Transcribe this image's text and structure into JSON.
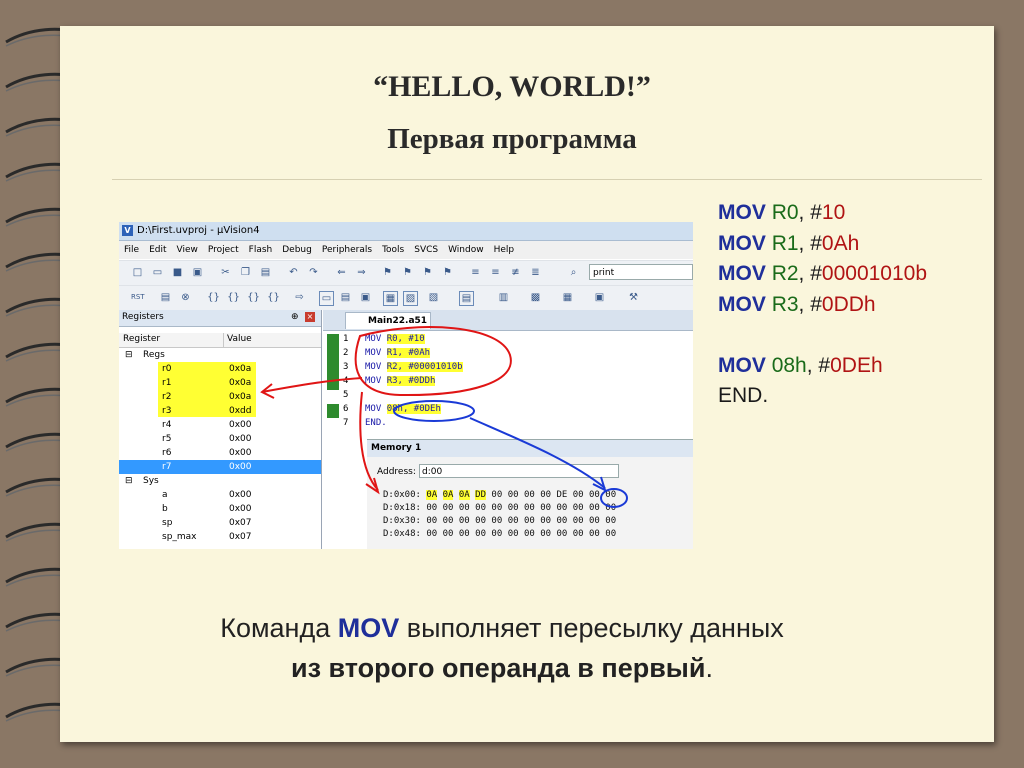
{
  "slide": {
    "title": "“HELLO, WORLD!”",
    "subtitle": "Первая программа",
    "caption_line1_pre": "Команда ",
    "caption_line1_kw": "MOV",
    "caption_line1_post": " выполняет пересылку данных",
    "caption_line2": "из второго операнда в первый",
    "caption_line2_end": "."
  },
  "code": [
    {
      "kw": "MOV",
      "a": "R0",
      "sep": ", #",
      "b": "10"
    },
    {
      "kw": "MOV",
      "a": "R1",
      "sep": ", #",
      "b": "0Ah"
    },
    {
      "kw": "MOV",
      "a": "R2",
      "sep": ", #",
      "b": "00001010b"
    },
    {
      "kw": "MOV",
      "a": "R3",
      "sep": ", #",
      "b": "0DDh"
    },
    {
      "kw": "MOV",
      "a": "08h",
      "sep": ", #",
      "b": "0DEh"
    },
    {
      "end": "END."
    }
  ],
  "ide": {
    "window_title": "D:\\First.uvproj - µVision4",
    "app_icon": "V",
    "menu": [
      "File",
      "Edit",
      "View",
      "Project",
      "Flash",
      "Debug",
      "Peripherals",
      "Tools",
      "SVCS",
      "Window",
      "Help"
    ],
    "toolbar_search": "print",
    "registers_pane": {
      "title": "Registers",
      "pin_icon": "pin-icon",
      "col_register": "Register",
      "col_value": "Value",
      "groups": [
        {
          "name": "Regs",
          "toggle": "⊟",
          "rows": [
            {
              "name": "r0",
              "value": "0x0a",
              "highlight": true
            },
            {
              "name": "r1",
              "value": "0x0a",
              "highlight": true
            },
            {
              "name": "r2",
              "value": "0x0a",
              "highlight": true
            },
            {
              "name": "r3",
              "value": "0xdd",
              "highlight": true
            },
            {
              "name": "r4",
              "value": "0x00",
              "highlight": false
            },
            {
              "name": "r5",
              "value": "0x00",
              "highlight": false
            },
            {
              "name": "r6",
              "value": "0x00",
              "highlight": false
            },
            {
              "name": "r7",
              "value": "0x00",
              "highlight": false,
              "selected": true
            }
          ]
        },
        {
          "name": "Sys",
          "toggle": "⊟",
          "rows": [
            {
              "name": "a",
              "value": "0x00"
            },
            {
              "name": "b",
              "value": "0x00"
            },
            {
              "name": "sp",
              "value": "0x07"
            },
            {
              "name": "sp_max",
              "value": "0x07"
            }
          ]
        }
      ]
    },
    "editor": {
      "tab": "Main22.a51",
      "lines": [
        {
          "n": "1",
          "kw": "MOV ",
          "ops": "R0, #10"
        },
        {
          "n": "2",
          "kw": "MOV ",
          "ops": "R1, #0Ah"
        },
        {
          "n": "3",
          "kw": "MOV ",
          "ops": "R2, #00001010b"
        },
        {
          "n": "4",
          "kw": "MOV ",
          "ops": "R3, #0DDh"
        },
        {
          "n": "5",
          "kw": "",
          "ops": ""
        },
        {
          "n": "6",
          "kw": "MOV ",
          "ops": "08h, #0DEh"
        },
        {
          "n": "7",
          "kw": "END.",
          "ops": ""
        }
      ]
    },
    "memory": {
      "title": "Memory 1",
      "address_label": "Address:",
      "address_value": "d:00",
      "rows": [
        {
          "addr": "D:0x00:",
          "bytes": [
            "0A",
            "0A",
            "0A",
            "DD",
            "00",
            "00",
            "00",
            "00",
            "DE",
            "00",
            "00",
            "00"
          ]
        },
        {
          "addr": "D:0x18:",
          "bytes": [
            "00",
            "00",
            "00",
            "00",
            "00",
            "00",
            "00",
            "00",
            "00",
            "00",
            "00",
            "00"
          ]
        },
        {
          "addr": "D:0x30:",
          "bytes": [
            "00",
            "00",
            "00",
            "00",
            "00",
            "00",
            "00",
            "00",
            "00",
            "00",
            "00",
            "00"
          ]
        },
        {
          "addr": "D:0x48:",
          "bytes": [
            "00",
            "00",
            "00",
            "00",
            "00",
            "00",
            "00",
            "00",
            "00",
            "00",
            "00",
            "00"
          ]
        }
      ]
    }
  },
  "colors": {
    "keyword": "#1f2f9a",
    "register": "#1a6b1a",
    "number": "#b01414",
    "annotation_red": "#e01515",
    "annotation_blue": "#1a3ad6"
  }
}
